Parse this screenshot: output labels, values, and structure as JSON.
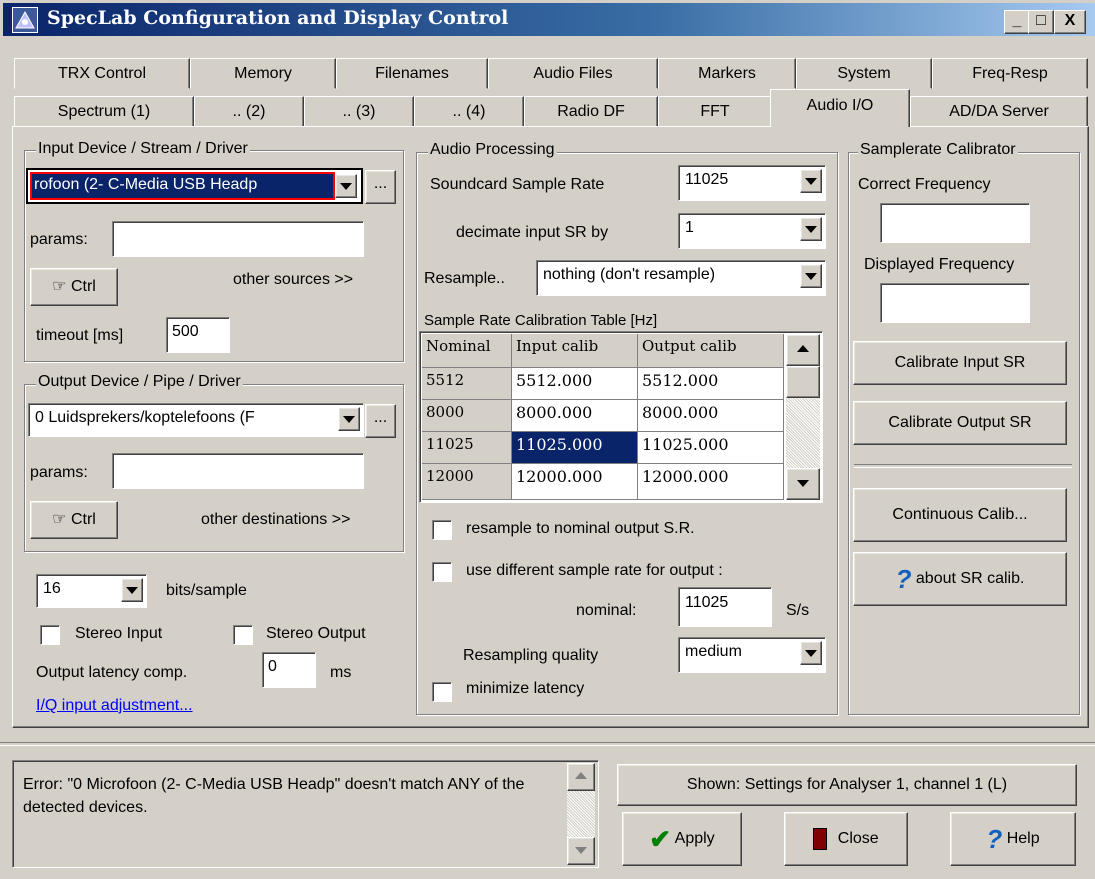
{
  "window": {
    "title": "SpecLab  Configuration and Display Control",
    "buttons": [
      "_",
      "□",
      "X"
    ]
  },
  "tabs_row1": [
    "TRX Control",
    "Memory",
    "Filenames",
    "Audio Files",
    "Markers",
    "System",
    "Freq-Resp"
  ],
  "tabs_row2": [
    "Spectrum (1)",
    ".. (2)",
    ".. (3)",
    ".. (4)",
    "Radio DF",
    "FFT",
    "Audio I/O",
    "AD/DA Server"
  ],
  "active_tab": "Audio I/O",
  "input": {
    "group_title": "Input Device / Stream / Driver",
    "device": "rofoon (2- C-Media USB Headp",
    "browse": "...",
    "params_label": "params:",
    "params_value": "",
    "ctrl": "Ctrl",
    "other": "other sources >>",
    "timeout_label": "timeout [ms]",
    "timeout_value": "500"
  },
  "output": {
    "group_title": "Output Device / Pipe / Driver",
    "device": "0 Luidsprekers/koptelefoons (F",
    "browse": "...",
    "params_label": "params:",
    "params_value": "",
    "ctrl": "Ctrl",
    "other": "other destinations >>"
  },
  "misc": {
    "bits_value": "16",
    "bits_label": "bits/sample",
    "stereo_input": "Stereo Input",
    "stereo_output": "Stereo Output",
    "latency_label": "Output latency comp.",
    "latency_value": "0",
    "latency_unit": "ms",
    "iq_link": "I/Q input adjustment..."
  },
  "audio": {
    "group_title": "Audio Processing",
    "sr_label": "Soundcard Sample Rate",
    "sr_value": "11025",
    "dec_label": "decimate input SR by",
    "dec_value": "1",
    "resample_label": "Resample..",
    "resample_value": "nothing (don't resample)",
    "table_title": "Sample Rate Calibration Table [Hz]",
    "table_headers": [
      "Nominal",
      "Input calib",
      "Output calib"
    ],
    "table_rows": [
      [
        "5512",
        "5512.000",
        "5512.000"
      ],
      [
        "8000",
        "8000.000",
        "8000.000"
      ],
      [
        "11025",
        "11025.000",
        "11025.000"
      ],
      [
        "12000",
        "12000.000",
        "12000.000"
      ]
    ],
    "resample_nominal": "resample to nominal output S.R.",
    "use_diff": "use different sample rate for output :",
    "nominal_label": "nominal:",
    "nominal_value": "11025",
    "nominal_unit": "S/s",
    "quality_label": "Resampling quality",
    "quality_value": "medium",
    "min_latency": "minimize latency"
  },
  "calib": {
    "group_title": "Samplerate Calibrator",
    "correct_label": "Correct Frequency",
    "correct_value": "",
    "displayed_label": "Displayed Frequency",
    "displayed_value": "",
    "cal_in": "Calibrate Input SR",
    "cal_out": "Calibrate Output SR",
    "continuous": "Continuous Calib...",
    "about": "about SR calib."
  },
  "status": {
    "message": "Error: \"0 Microfoon (2- C-Media USB Headp\" doesn't match ANY of the detected devices.",
    "shown": "Shown: Settings for Analyser 1, channel 1 (L)",
    "apply": "Apply",
    "close": "Close",
    "help": "Help"
  },
  "colors": {
    "titlebar": "#0a246a",
    "selection": "#0a246a",
    "error_border": "#ff0000",
    "face": "#d4d0c8"
  }
}
